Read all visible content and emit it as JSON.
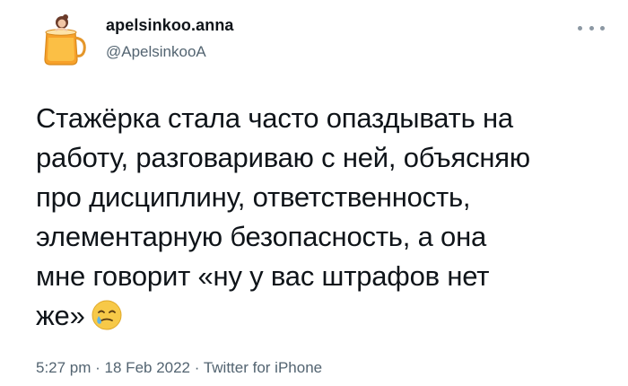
{
  "tweet": {
    "author": {
      "name": "apelsinkoo.anna",
      "handle": "@ApelsinkooA"
    },
    "more_icon": "more-dots-icon",
    "text_lines": [
      "Стажёрка стала часто опаздывать на",
      "работу, разговариваю с ней, объясняю",
      "про дисциплину, ответственность,",
      "элементарную безопасность, а она",
      "мне говорит «ну у вас штрафов нет",
      "же»"
    ],
    "emoji": "crying-face-with-tear-emoji",
    "meta": {
      "time": "5:27 pm",
      "separator": " · ",
      "date": "18 Feb 2022",
      "source": "Twitter for iPhone"
    }
  },
  "colors": {
    "text": "#0f1419",
    "secondary": "#536471",
    "emoji_face": "#f7c948",
    "tear": "#5fb4e6"
  }
}
